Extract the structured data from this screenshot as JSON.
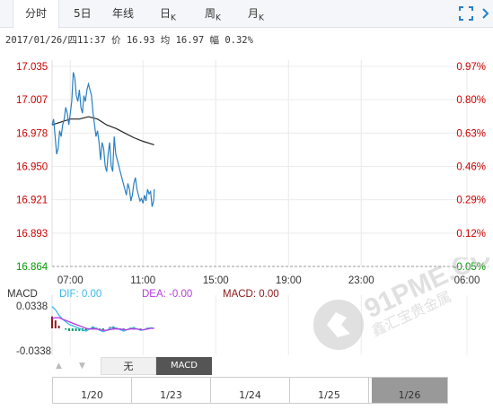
{
  "tabs": [
    {
      "label": "分时",
      "sub": "",
      "active": true
    },
    {
      "label": "5日",
      "sub": "",
      "active": false
    },
    {
      "label": "年线",
      "sub": "",
      "active": false
    },
    {
      "label": "日",
      "sub": "K",
      "active": false
    },
    {
      "label": "周",
      "sub": "K",
      "active": false
    },
    {
      "label": "月",
      "sub": "K",
      "active": false
    }
  ],
  "icons": {
    "fullscreen": "fullscreen-icon",
    "more": "chevron-right-icon"
  },
  "info": {
    "datetime": "2017/01/26/四11:37",
    "price_label": "价",
    "price": "16.93",
    "avg_label": "均",
    "avg": "16.97",
    "range_label": "幅",
    "range": "0.32%"
  },
  "chart_data": {
    "type": "line",
    "y_ticks": [
      "17.035",
      "17.007",
      "16.978",
      "16.950",
      "16.921",
      "16.893",
      "16.864"
    ],
    "pct_ticks": [
      "0.97%",
      "0.80%",
      "0.63%",
      "0.46%",
      "0.29%",
      "0.12%",
      "-0.05%"
    ],
    "x_ticks": [
      "07:00",
      "11:00",
      "15:00",
      "19:00",
      "23:00",
      "06:00"
    ],
    "ylim": [
      16.864,
      17.035
    ],
    "price_series": [
      [
        "06:00",
        16.985
      ],
      [
        "06:05",
        16.99
      ],
      [
        "06:10",
        16.975
      ],
      [
        "06:15",
        16.96
      ],
      [
        "06:20",
        16.965
      ],
      [
        "06:25",
        16.98
      ],
      [
        "06:30",
        16.975
      ],
      [
        "06:35",
        16.985
      ],
      [
        "06:40",
        16.99
      ],
      [
        "06:45",
        17.0
      ],
      [
        "06:50",
        16.995
      ],
      [
        "06:55",
        16.985
      ],
      [
        "07:00",
        16.995
      ],
      [
        "07:05",
        17.005
      ],
      [
        "07:10",
        17.03
      ],
      [
        "07:15",
        17.025
      ],
      [
        "07:20",
        17.01
      ],
      [
        "07:25",
        17.005
      ],
      [
        "07:30",
        17.015
      ],
      [
        "07:35",
        17.0
      ],
      [
        "07:40",
        16.995
      ],
      [
        "07:45",
        17.01
      ],
      [
        "07:50",
        17.005
      ],
      [
        "07:55",
        17.015
      ],
      [
        "08:00",
        17.02
      ],
      [
        "08:05",
        17.015
      ],
      [
        "08:10",
        17.01
      ],
      [
        "08:15",
        16.995
      ],
      [
        "08:20",
        16.985
      ],
      [
        "08:25",
        16.975
      ],
      [
        "08:30",
        16.98
      ],
      [
        "08:35",
        16.97
      ],
      [
        "08:40",
        16.955
      ],
      [
        "08:45",
        16.97
      ],
      [
        "08:50",
        16.965
      ],
      [
        "08:55",
        16.95
      ],
      [
        "09:00",
        16.945
      ],
      [
        "09:05",
        16.96
      ],
      [
        "09:10",
        16.97
      ],
      [
        "09:15",
        16.95
      ],
      [
        "09:20",
        16.945
      ],
      [
        "09:25",
        16.975
      ],
      [
        "09:30",
        16.96
      ],
      [
        "09:35",
        16.955
      ],
      [
        "09:40",
        16.95
      ],
      [
        "09:45",
        16.945
      ],
      [
        "09:50",
        16.94
      ],
      [
        "09:55",
        16.935
      ],
      [
        "10:00",
        16.93
      ],
      [
        "10:05",
        16.925
      ],
      [
        "10:10",
        16.935
      ],
      [
        "10:15",
        16.93
      ],
      [
        "10:20",
        16.92
      ],
      [
        "10:25",
        16.925
      ],
      [
        "10:30",
        16.935
      ],
      [
        "10:35",
        16.94
      ],
      [
        "10:40",
        16.93
      ],
      [
        "10:45",
        16.925
      ],
      [
        "10:50",
        16.92
      ],
      [
        "10:55",
        16.922
      ],
      [
        "11:00",
        16.918
      ],
      [
        "11:05",
        16.925
      ],
      [
        "11:10",
        16.92
      ],
      [
        "11:15",
        16.93
      ],
      [
        "11:20",
        16.926
      ],
      [
        "11:25",
        16.928
      ],
      [
        "11:30",
        16.915
      ],
      [
        "11:35",
        16.92
      ],
      [
        "11:37",
        16.93
      ]
    ],
    "avg_series": [
      [
        "06:00",
        16.985
      ],
      [
        "07:00",
        16.99
      ],
      [
        "07:30",
        16.99
      ],
      [
        "08:00",
        16.992
      ],
      [
        "08:30",
        16.99
      ],
      [
        "09:00",
        16.985
      ],
      [
        "09:30",
        16.982
      ],
      [
        "10:00",
        16.978
      ],
      [
        "10:30",
        16.974
      ],
      [
        "11:00",
        16.971
      ],
      [
        "11:37",
        16.968
      ]
    ],
    "prev_close": 16.873,
    "macd": {
      "label": "MACD",
      "dif_label": "DIF: 0.00",
      "dea_label": "DEA: -0.00",
      "macd_label": "MACD: 0.00",
      "y_ticks": [
        "0.0338",
        "-0.0338"
      ],
      "ylim": [
        -0.0338,
        0.0338
      ],
      "dif": [
        0.033,
        0.028,
        0.02,
        0.014,
        0.01,
        0.006,
        0.004,
        0.002,
        0.0,
        -0.002,
        -0.004,
        -0.001,
        0.002,
        0.0,
        -0.003,
        -0.005,
        -0.003,
        0.0,
        0.002,
        0.0,
        -0.002,
        -0.004,
        -0.002,
        0.0,
        0.001,
        -0.001,
        -0.003,
        -0.002,
        0.0,
        0.001,
        0.0
      ],
      "dea": [
        0.015,
        0.016,
        0.016,
        0.014,
        0.012,
        0.01,
        0.008,
        0.006,
        0.004,
        0.002,
        0.0,
        -0.001,
        -0.001,
        -0.001,
        -0.002,
        -0.003,
        -0.003,
        -0.002,
        -0.001,
        -0.001,
        -0.001,
        -0.002,
        -0.002,
        -0.001,
        -0.001,
        -0.001,
        -0.002,
        -0.002,
        -0.001,
        0.0,
        0.0
      ],
      "hist": [
        0.018,
        0.012,
        0.004,
        0.0,
        -0.002,
        -0.004,
        -0.004,
        -0.004,
        -0.004,
        -0.004,
        -0.004,
        0.0,
        0.003,
        0.001,
        -0.001,
        -0.002,
        0.0,
        0.002,
        0.003,
        0.001,
        -0.001,
        -0.002,
        0.0,
        0.001,
        0.002,
        0.0,
        -0.001,
        0.0,
        0.001,
        0.001,
        0.0
      ]
    },
    "grid": true
  },
  "indicator": {
    "left_arrow": "▲",
    "right_arrow": "▼",
    "none_label": "无",
    "macd_label": "MACD"
  },
  "date_nav": [
    "1/20",
    "1/23",
    "1/24",
    "1/25",
    "1/26"
  ],
  "watermark": {
    "line1": "91PME.COM",
    "line2": "鑫汇宝贵金属"
  },
  "colors": {
    "up": "#cc0000",
    "down": "#009900",
    "price": "#2a80c4",
    "avg": "#222222",
    "dif": "#3bb7e8",
    "dea": "#b53ee0",
    "macd": "#8a1a1a"
  }
}
